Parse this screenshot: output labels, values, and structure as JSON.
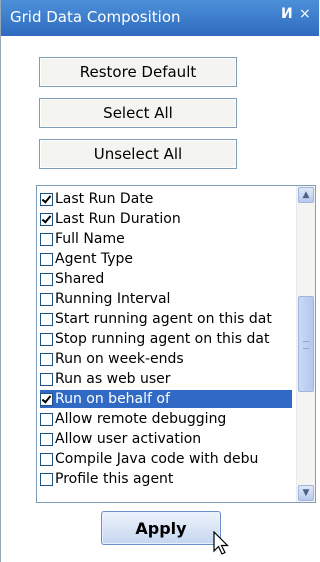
{
  "panel": {
    "title": "Grid Data Composition",
    "pin_icon": "И",
    "close_icon": "×"
  },
  "buttons": {
    "restore_default": "Restore Default",
    "select_all": "Select All",
    "unselect_all": "Unselect All",
    "apply": "Apply"
  },
  "list": {
    "items": [
      {
        "label": "Last Run Date",
        "checked": true,
        "selected": false
      },
      {
        "label": "Last Run Duration",
        "checked": true,
        "selected": false
      },
      {
        "label": "Full Name",
        "checked": false,
        "selected": false
      },
      {
        "label": "Agent Type",
        "checked": false,
        "selected": false
      },
      {
        "label": "Shared",
        "checked": false,
        "selected": false
      },
      {
        "label": "Running Interval",
        "checked": false,
        "selected": false
      },
      {
        "label": "Start running agent on this dat",
        "checked": false,
        "selected": false
      },
      {
        "label": "Stop running agent on this dat",
        "checked": false,
        "selected": false
      },
      {
        "label": "Run on week-ends",
        "checked": false,
        "selected": false
      },
      {
        "label": "Run as web user",
        "checked": false,
        "selected": false
      },
      {
        "label": "Run on behalf of",
        "checked": true,
        "selected": true
      },
      {
        "label": "Allow remote debugging",
        "checked": false,
        "selected": false
      },
      {
        "label": "Allow user activation",
        "checked": false,
        "selected": false
      },
      {
        "label": "Compile Java code with debu",
        "checked": false,
        "selected": false
      },
      {
        "label": "Profile this agent",
        "checked": false,
        "selected": false
      }
    ]
  },
  "icons": {
    "scroll_up": "scroll-up-icon",
    "scroll_down": "scroll-down-icon",
    "cursor": "mouse-cursor-icon"
  },
  "colors": {
    "title_bar": "#3b7bd0",
    "selection": "#316ac5",
    "button_border": "#7f9db9"
  }
}
